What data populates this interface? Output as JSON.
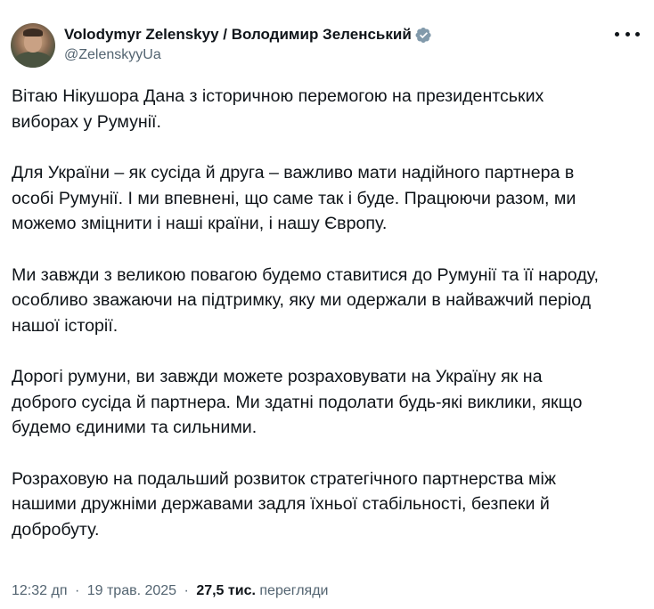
{
  "author": {
    "display_name": "Volodymyr Zelenskyy / Володимир Зеленський",
    "handle": "@ZelenskyyUa",
    "verified_color": "#829aab"
  },
  "post": {
    "paragraphs": [
      "Вітаю Нікушора Дана з історичною перемогою на президентських\nвиборах у Румунії.",
      "Для України – як сусіда й друга – важливо мати надійного партнера в\nособі Румунії. І ми впевнені, що саме так і буде. Працюючи разом, ми\nможемо зміцнити і наші країни, і нашу Європу.",
      "Ми завжди з великою повагою будемо ставитися до Румунії та її народу,\nособливо зважаючи на підтримку, яку ми одержали в найважчий період\nнашої історії.",
      "Дорогі румуни, ви завжди можете розраховувати на Україну як на\nдоброго сусіда й партнера. Ми здатні подолати будь-які виклики, якщо\nбудемо єдиними та сильними.",
      "Розраховую на подальший розвиток стратегічного партнерства між\nнашими дружніми державами задля їхньої стабільності, безпеки й\nдобробуту."
    ]
  },
  "meta": {
    "time": "12:32 дп",
    "separator": "·",
    "date": "19 трав. 2025",
    "views_count": "27,5 тис.",
    "views_label": "перегляди"
  },
  "icons": {
    "more": "more-horizontal-icon",
    "verified": "verified-badge-icon"
  }
}
